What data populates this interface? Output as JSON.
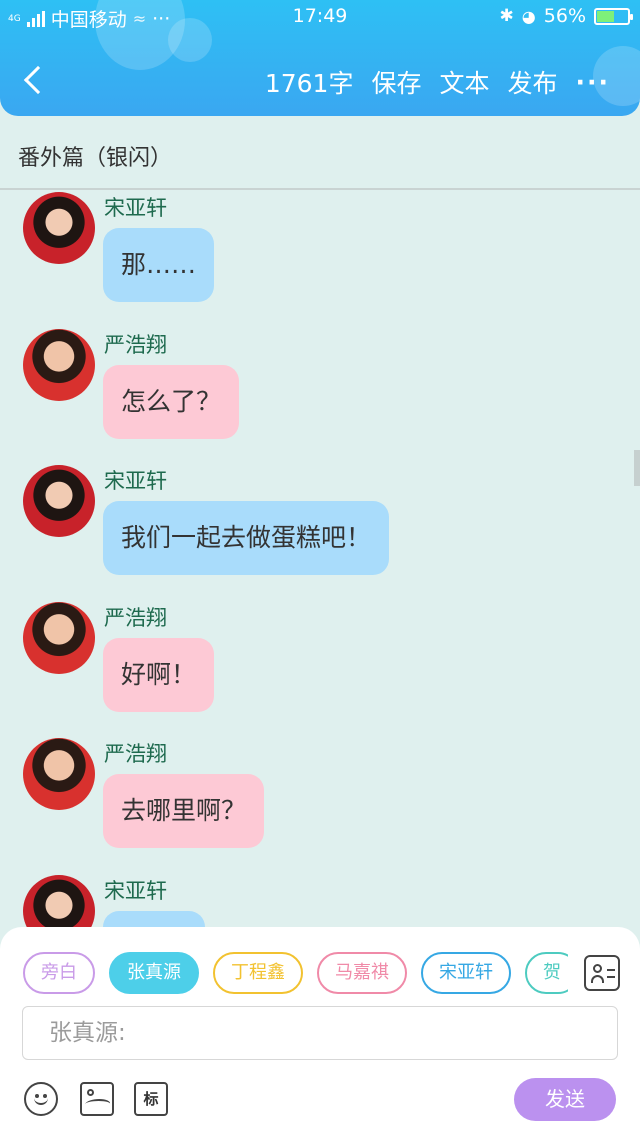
{
  "status_bar": {
    "network_type": "4G",
    "carrier": "中国移动",
    "more": "···",
    "time": "17:49",
    "battery": "56%",
    "battery_level": 0.56
  },
  "header": {
    "word_count": "1761字",
    "save_label": "保存",
    "text_label": "文本",
    "publish_label": "发布",
    "more_label": "···"
  },
  "title": "番外篇（银闪）",
  "messages": [
    {
      "speaker": "宋亚轩",
      "text": "那……",
      "color": "blue"
    },
    {
      "speaker": "严浩翔",
      "text": "怎么了？",
      "color": "pink"
    },
    {
      "speaker": "宋亚轩",
      "text": "我们一起去做蛋糕吧！",
      "color": "blue"
    },
    {
      "speaker": "严浩翔",
      "text": "好啊！",
      "color": "pink"
    },
    {
      "speaker": "严浩翔",
      "text": "去哪里啊？",
      "color": "pink"
    },
    {
      "speaker": "宋亚轩",
      "text": "",
      "color": "blue"
    }
  ],
  "composer": {
    "chips": [
      {
        "label": "旁白",
        "color": "#c99be8",
        "selected": false
      },
      {
        "label": "张真源",
        "color": "#4dcfe9",
        "selected": true
      },
      {
        "label": "丁程鑫",
        "color": "#f2c230",
        "selected": false
      },
      {
        "label": "马嘉祺",
        "color": "#f08aa8",
        "selected": false
      },
      {
        "label": "宋亚轩",
        "color": "#36a8e4",
        "selected": false
      },
      {
        "label": "贺",
        "color": "#4dcbc0",
        "selected": false
      }
    ],
    "input_placeholder": "张真源:",
    "mark_label": "标",
    "send_label": "发送"
  },
  "colors": {
    "header": "#2ec0f4",
    "background": "#dff0ee",
    "bubble_blue": "#a9dcfb",
    "bubble_pink": "#fdc9d5",
    "send_button": "#bb91ef"
  }
}
